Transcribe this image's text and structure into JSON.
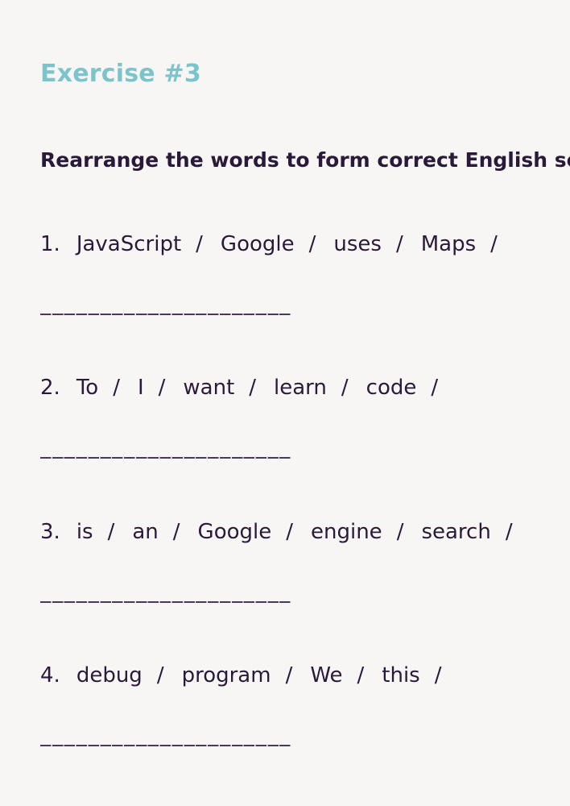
{
  "exercise": {
    "title": "Exercise #3",
    "instruction": "Rearrange the words to form correct English sen",
    "separator": "/",
    "questions": [
      {
        "number": "1.",
        "words": [
          "JavaScript",
          "Google",
          "uses",
          "Maps"
        ],
        "answer": ""
      },
      {
        "number": "2.",
        "words": [
          "To",
          "I",
          "want",
          "learn",
          "code"
        ],
        "answer": ""
      },
      {
        "number": "3.",
        "words": [
          "is",
          "an",
          "Google",
          "engine",
          "search"
        ],
        "answer": ""
      },
      {
        "number": "4.",
        "words": [
          "debug",
          "program",
          "We",
          "this"
        ],
        "answer": ""
      }
    ]
  },
  "colors": {
    "title": "#7cc4cb",
    "text": "#2a1a3a",
    "background": "#f8f6f4",
    "answer_line": "#4a3a5a"
  }
}
